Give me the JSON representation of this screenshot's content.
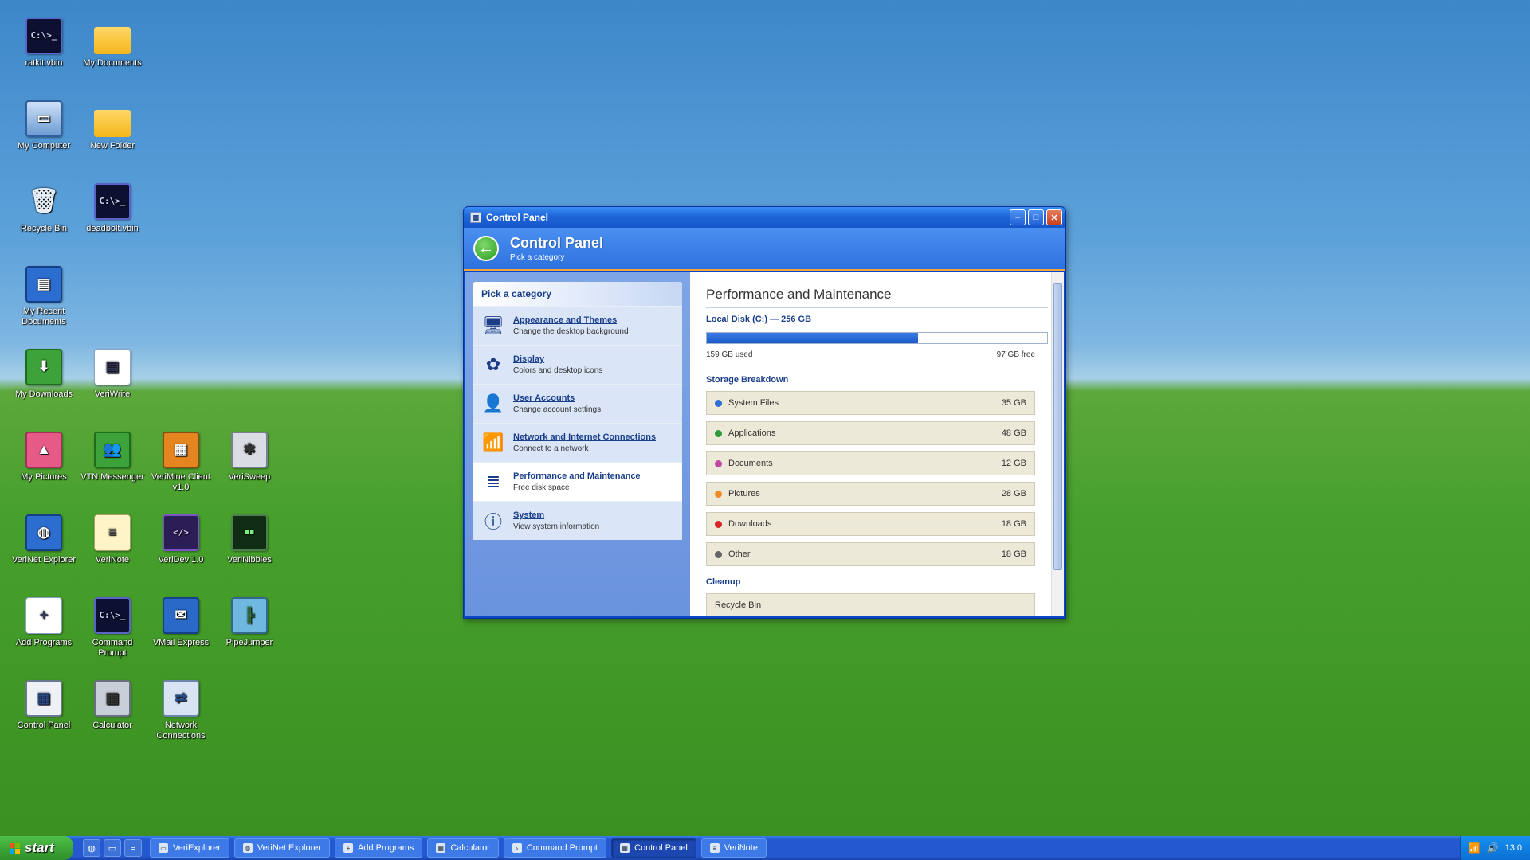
{
  "desktop": {
    "icons": [
      {
        "label": "ratkit.vbin",
        "glyph": "C:\\>_"
      },
      {
        "label": "My Documents",
        "glyph": ""
      },
      {
        "label": "My Computer",
        "glyph": "▭"
      },
      {
        "label": "New Folder",
        "glyph": ""
      },
      {
        "label": "Recycle Bin",
        "glyph": "🗑"
      },
      {
        "label": "deadbolt.vbin",
        "glyph": "C:\\>_"
      },
      {
        "label": "My Recent Documents",
        "glyph": "▤"
      },
      {
        "label": "My Downloads",
        "glyph": "⬇"
      },
      {
        "label": "VeriWrite",
        "glyph": "▤"
      },
      {
        "label": "My Pictures",
        "glyph": "▲"
      },
      {
        "label": "VTN Messenger",
        "glyph": "👥"
      },
      {
        "label": "VeriMine Client v1.0",
        "glyph": "▦"
      },
      {
        "label": "VeriSweep",
        "glyph": "✱"
      },
      {
        "label": "VeriNet Explorer",
        "glyph": "◍"
      },
      {
        "label": "VeriNote",
        "glyph": "≡"
      },
      {
        "label": "VeriDev 1.0",
        "glyph": "</>"
      },
      {
        "label": "VeriNibbles",
        "glyph": "▪▪"
      },
      {
        "label": "Add Programs",
        "glyph": "+"
      },
      {
        "label": "Command Prompt",
        "glyph": "C:\\>_"
      },
      {
        "label": "VMail Express",
        "glyph": "✉"
      },
      {
        "label": "PipeJumper",
        "glyph": "╠"
      },
      {
        "label": "Control Panel",
        "glyph": "▦"
      },
      {
        "label": "Calculator",
        "glyph": "▦"
      },
      {
        "label": "Network Connections",
        "glyph": "⇄"
      }
    ]
  },
  "window": {
    "title": "Control Panel",
    "header_title": "Control Panel",
    "header_sub": "Pick a category",
    "sidebar": {
      "heading": "Pick a category",
      "items": [
        {
          "title": "Appearance and Themes",
          "desc": "Change the desktop background",
          "icon": "🖥"
        },
        {
          "title": "Display",
          "desc": "Colors and desktop icons",
          "icon": "✿"
        },
        {
          "title": "User Accounts",
          "desc": "Change account settings",
          "icon": "👤"
        },
        {
          "title": "Network and Internet Connections",
          "desc": "Connect to a network",
          "icon": "📶"
        },
        {
          "title": "Performance and Maintenance",
          "desc": "Free disk space",
          "icon": "≣"
        },
        {
          "title": "System",
          "desc": "View system information",
          "icon": "ⓘ"
        }
      ]
    },
    "main": {
      "heading": "Performance and Maintenance",
      "disk_title": "Local Disk (C:) — 256 GB",
      "used_label": "159 GB used",
      "free_label": "97 GB free",
      "used_fraction": 0.62,
      "breakdown_title": "Storage Breakdown",
      "breakdown": [
        {
          "name": "System Files",
          "value": "35 GB",
          "color": "#2f6fd6"
        },
        {
          "name": "Applications",
          "value": "48 GB",
          "color": "#2e9a3a"
        },
        {
          "name": "Documents",
          "value": "12 GB",
          "color": "#c246a6"
        },
        {
          "name": "Pictures",
          "value": "28 GB",
          "color": "#f08a23"
        },
        {
          "name": "Downloads",
          "value": "18 GB",
          "color": "#d82525"
        },
        {
          "name": "Other",
          "value": "18 GB",
          "color": "#666666"
        }
      ],
      "cleanup_title": "Cleanup",
      "cleanup_first": "Recycle Bin"
    }
  },
  "taskbar": {
    "start_label": "start",
    "tasks": [
      "VeriExplorer",
      "VeriNet Explorer",
      "Add Programs",
      "Calculator",
      "Command Prompt",
      "Control Panel",
      "VeriNote"
    ],
    "active_task": "Control Panel",
    "clock": "13:0"
  }
}
